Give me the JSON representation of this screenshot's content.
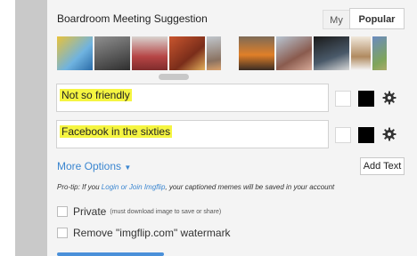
{
  "template": {
    "title": "Boardroom Meeting Suggestion"
  },
  "tabs": [
    {
      "label": "My",
      "active": false
    },
    {
      "label": "Popular",
      "active": true
    }
  ],
  "text_boxes": [
    {
      "value": "Not so friendly"
    },
    {
      "value": "Facebook in the sixties"
    }
  ],
  "options": {
    "more_options_label": "More Options",
    "add_text_label": "Add Text"
  },
  "protip": {
    "lead": "Pro-tip: If you ",
    "login_link": "Login or Join Imgflip",
    "tail": ", your captioned memes will be saved in your account"
  },
  "checkboxes": [
    {
      "label": "Private",
      "note": "(must download image to save or share)",
      "checked": false
    },
    {
      "label": "Remove \"imgflip.com\" watermark",
      "note": "",
      "checked": false
    }
  ],
  "colors": {
    "accent": "#3b86d0",
    "highlight": "#f5f541",
    "swatch_primary": "#ffffff",
    "swatch_outline": "#000000"
  }
}
